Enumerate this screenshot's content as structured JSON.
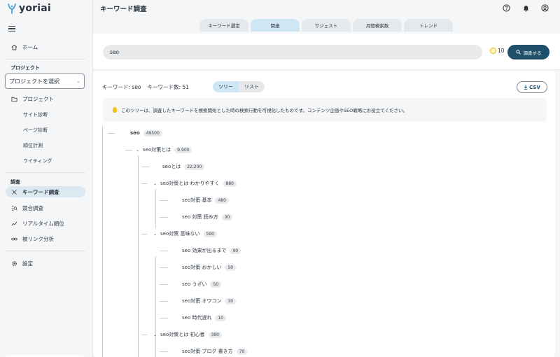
{
  "app": {
    "name": "yoriai",
    "page_title": "キーワード調査"
  },
  "sidebar": {
    "home": "ホーム",
    "project_section": "プロジェクト",
    "project_select": "プロジェクトを選択",
    "project_item": "プロジェクト",
    "project_subs": [
      "サイト診断",
      "ページ診断",
      "順位計測",
      "ライティング"
    ],
    "research_section": "調査",
    "research_items": [
      "キーワード調査",
      "競合調査",
      "リアルタイム順位",
      "被リンク分析"
    ],
    "settings": "設定"
  },
  "tabs": [
    {
      "label": "キーワード選定",
      "active": false
    },
    {
      "label": "関連",
      "active": true
    },
    {
      "label": "サジェスト",
      "active": false
    },
    {
      "label": "月間検索数",
      "active": false
    },
    {
      "label": "トレンド",
      "active": false
    }
  ],
  "search": {
    "value": "seo",
    "credits": "10",
    "button": "調査する"
  },
  "content": {
    "keyword_label": "キーワード: seo",
    "count_label": "キーワード数: 51",
    "view_tree": "ツリー",
    "view_list": "リスト",
    "csv": "CSV",
    "info": "このツリーは、調査したキーワードを検索開始とした時の検索行動を可視化したものです。コンテンツ企画やSEO戦略にお役立てください。"
  },
  "tree": [
    {
      "kw": "seo",
      "vol": "49500"
    },
    {
      "kw": "seo対策とは",
      "vol": "9,900"
    },
    {
      "kw": "seoとは",
      "vol": "22,200"
    },
    {
      "kw": "seo対策とは わかりやすく",
      "vol": "880"
    },
    {
      "kw": "seo対策 基本",
      "vol": "480"
    },
    {
      "kw": "seo 対策 読み方",
      "vol": "30"
    },
    {
      "kw": "seo対策 意味ない",
      "vol": "590"
    },
    {
      "kw": "seo 効果が出るまで",
      "vol": "90"
    },
    {
      "kw": "seo対策 おかしい",
      "vol": "50"
    },
    {
      "kw": "seo うざい",
      "vol": "50"
    },
    {
      "kw": "seo対策 オワコン",
      "vol": "30"
    },
    {
      "kw": "seo 時代遅れ",
      "vol": "10"
    },
    {
      "kw": "seo対策とは 初心者",
      "vol": "390"
    },
    {
      "kw": "seo対策 ブログ 書き方",
      "vol": "70"
    }
  ]
}
